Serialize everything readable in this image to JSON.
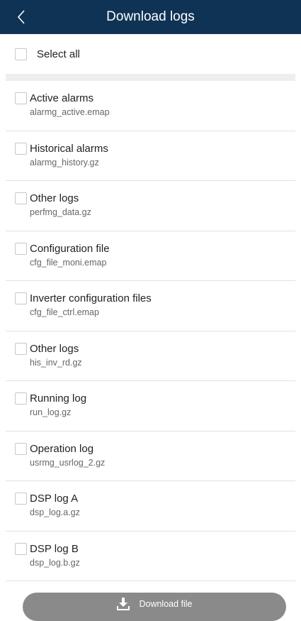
{
  "header": {
    "title": "Download logs",
    "back_icon": "chevron-left-icon"
  },
  "select_all": {
    "label": "Select all",
    "checked": false
  },
  "logs": [
    {
      "name": "Active alarms",
      "file": "alarmg_active.emap",
      "checked": false
    },
    {
      "name": "Historical alarms",
      "file": "alarmg_history.gz",
      "checked": false
    },
    {
      "name": "Other logs",
      "file": "perfmg_data.gz",
      "checked": false
    },
    {
      "name": "Configuration file",
      "file": "cfg_file_moni.emap",
      "checked": false
    },
    {
      "name": "Inverter configuration files",
      "file": "cfg_file_ctrl.emap",
      "checked": false
    },
    {
      "name": "Other logs",
      "file": "his_inv_rd.gz",
      "checked": false
    },
    {
      "name": "Running log",
      "file": "run_log.gz",
      "checked": false
    },
    {
      "name": "Operation log",
      "file": "usrmg_usrlog_2.gz",
      "checked": false
    },
    {
      "name": "DSP log A",
      "file": "dsp_log.a.gz",
      "checked": false
    },
    {
      "name": "DSP log B",
      "file": "dsp_log.b.gz",
      "checked": false
    }
  ],
  "download": {
    "label": "Download file",
    "icon": "download-icon"
  },
  "colors": {
    "header_bg": "#0e3354",
    "button_bg": "#8a8a8a"
  }
}
